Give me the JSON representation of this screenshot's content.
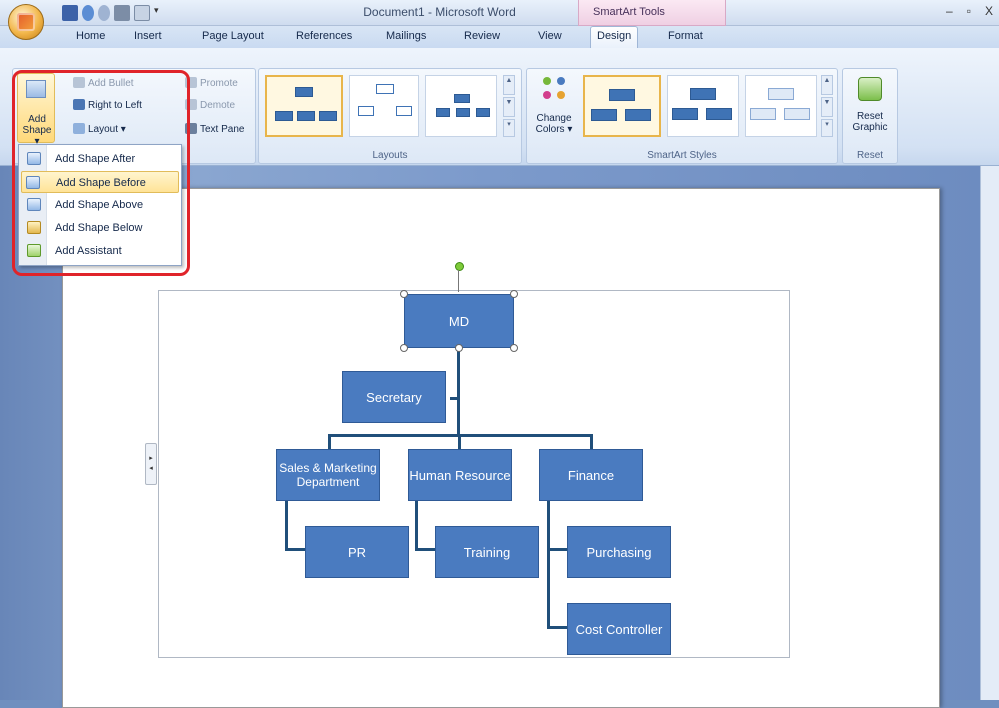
{
  "window": {
    "title": "Document1 - Microsoft Word",
    "context_tab_group": "SmartArt Tools",
    "controls": [
      "–",
      "▫",
      "X"
    ]
  },
  "tabs": [
    {
      "label": "Home"
    },
    {
      "label": "Insert"
    },
    {
      "label": "Page Layout"
    },
    {
      "label": "References"
    },
    {
      "label": "Mailings"
    },
    {
      "label": "Review"
    },
    {
      "label": "View"
    },
    {
      "label": "Design",
      "active": true
    },
    {
      "label": "Format"
    }
  ],
  "ribbon": {
    "create_graphic": {
      "add_shape": "Add Shape",
      "add_shape_caret": "Add Shape ▾",
      "add_bullet": "Add Bullet",
      "right_to_left": "Right to Left",
      "layout": "Layout ▾",
      "promote": "Promote",
      "demote": "Demote",
      "text_pane": "Text Pane"
    },
    "layouts_group": "Layouts",
    "change_colors": "Change Colors ▾",
    "smartart_styles_group": "SmartArt Styles",
    "reset_graphic": "Reset Graphic",
    "reset_group": "Reset"
  },
  "add_shape_menu": [
    {
      "label": "Add Shape After",
      "icon": "add-shape-after-icon"
    },
    {
      "label": "Add Shape Before",
      "icon": "add-shape-before-icon",
      "highlighted": true
    },
    {
      "label": "Add Shape Above",
      "icon": "add-shape-above-icon"
    },
    {
      "label": "Add Shape Below",
      "icon": "add-shape-below-icon"
    },
    {
      "label": "Add Assistant",
      "icon": "add-assistant-icon"
    }
  ],
  "org_chart": {
    "md": "MD",
    "secretary": "Secretary",
    "sales": "Sales & Marketing Department",
    "hr": "Human Resource",
    "finance": "Finance",
    "pr": "PR",
    "training": "Training",
    "purchasing": "Purchasing",
    "cost_controller": "Cost Controller"
  },
  "colors": {
    "node_fill": "#4a7bc0",
    "connector": "#204f7a",
    "highlight_box": "#e0242a",
    "menu_highlight": "#ffe397"
  }
}
